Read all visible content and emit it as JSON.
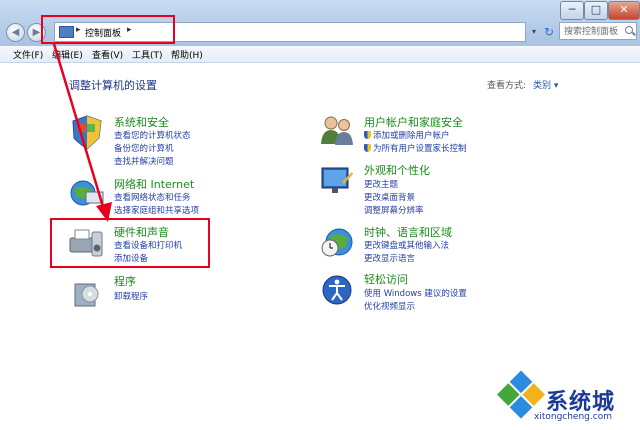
{
  "window": {
    "minimize": "─",
    "maximize": "□",
    "close": "✕"
  },
  "nav": {
    "back": "◀",
    "forward": "▶"
  },
  "address": {
    "sep": "▸",
    "text": "控制面板",
    "drop": "▾",
    "refresh": "↻"
  },
  "search": {
    "placeholder": "搜索控制面板"
  },
  "menu": [
    "文件(F)",
    "编辑(E)",
    "查看(V)",
    "工具(T)",
    "帮助(H)"
  ],
  "main": {
    "headline": "调整计算机的设置",
    "view_by_label": "查看方式:",
    "view_by_value": "类别 ▾"
  },
  "categories_left": [
    {
      "title": "系统和安全",
      "links": [
        "查看您的计算机状态",
        "备份您的计算机",
        "查找并解决问题"
      ],
      "icon": "shield-flag-icon"
    },
    {
      "title": "网络和 Internet",
      "links": [
        "查看网络状态和任务",
        "选择家庭组和共享选项"
      ],
      "icon": "network-globe-icon"
    },
    {
      "title": "硬件和声音",
      "links": [
        "查看设备和打印机",
        "添加设备"
      ],
      "icon": "printer-speaker-icon"
    },
    {
      "title": "程序",
      "links": [
        "卸载程序"
      ],
      "icon": "programs-icon"
    }
  ],
  "categories_right": [
    {
      "title": "用户帐户和家庭安全",
      "links": [
        "添加或删除用户帐户",
        "为所有用户设置家长控制"
      ],
      "shielded": [
        true,
        true
      ],
      "icon": "users-icon"
    },
    {
      "title": "外观和个性化",
      "links": [
        "更改主题",
        "更改桌面背景",
        "调整屏幕分辨率"
      ],
      "shielded": [
        false,
        false,
        false
      ],
      "icon": "display-icon"
    },
    {
      "title": "时钟、语言和区域",
      "links": [
        "更改键盘或其他输入法",
        "更改显示语言"
      ],
      "shielded": [
        false,
        false
      ],
      "icon": "clock-globe-icon"
    },
    {
      "title": "轻松访问",
      "links": [
        "使用 Windows 建议的设置",
        "优化视频显示"
      ],
      "shielded": [
        false,
        false
      ],
      "icon": "accessibility-icon"
    }
  ],
  "watermark": {
    "text": "系统城",
    "sub": "xitongcheng.com"
  },
  "colors": {
    "accent": "#1e3287",
    "category_green": "#1b8a1b",
    "annotation_red": "#e8001f"
  }
}
